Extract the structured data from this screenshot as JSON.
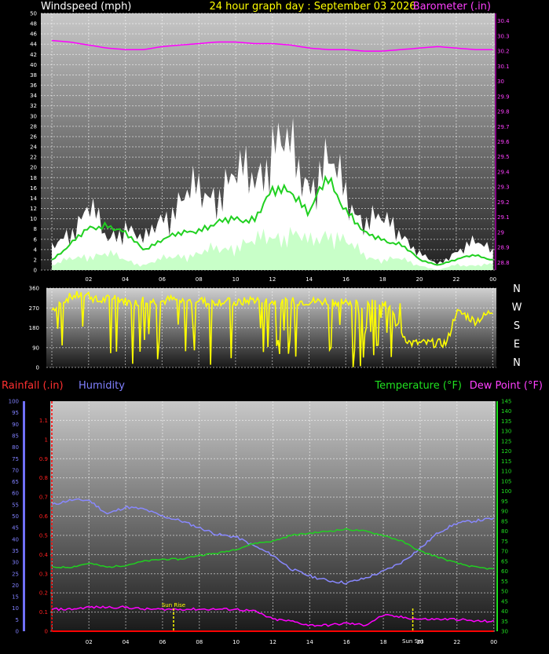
{
  "chart_data": [
    {
      "type": "line",
      "title": "24 hour graph day : September 03 2026",
      "left_label": "Windspeed (mph)",
      "right_label": "Barometer (.in)",
      "y_left_ticks": [
        "0",
        "2",
        "4",
        "6",
        "8",
        "10",
        "12",
        "14",
        "16",
        "18",
        "20",
        "22",
        "24",
        "26",
        "28",
        "30",
        "32",
        "34",
        "36",
        "38",
        "40",
        "42",
        "44",
        "46",
        "48",
        "50"
      ],
      "y_right_ticks": [
        "28.8",
        "28.9",
        "29",
        "29.1",
        "29.2",
        "29.3",
        "29.4",
        "29.5",
        "29.6",
        "29.7",
        "29.8",
        "29.9",
        "30",
        "30.1",
        "30.2",
        "30.3",
        "30.4"
      ],
      "x_ticks": [
        "02",
        "04",
        "06",
        "08",
        "10",
        "12",
        "14",
        "16",
        "18",
        "20",
        "22",
        "00"
      ],
      "ylim_left": [
        0,
        50
      ],
      "ylim_right": [
        28.75,
        30.45
      ],
      "hours": [
        0,
        1,
        2,
        3,
        4,
        5,
        6,
        7,
        8,
        9,
        10,
        11,
        12,
        13,
        14,
        15,
        16,
        17,
        18,
        19,
        20,
        21,
        22,
        23,
        24
      ],
      "series": [
        {
          "key": "gust",
          "color": "#ffffff",
          "values": [
            4,
            8,
            12,
            6,
            9,
            5,
            11,
            13,
            15,
            16,
            17,
            19,
            24,
            22,
            18,
            20,
            15,
            10,
            9,
            8,
            3,
            1,
            4,
            5,
            4
          ]
        },
        {
          "key": "average",
          "color": "#20d020",
          "values": [
            2,
            5,
            8,
            9,
            7,
            4,
            6,
            7,
            8,
            9,
            10,
            10,
            15,
            16,
            11,
            18,
            12,
            7,
            6,
            5,
            2,
            1,
            2,
            3,
            2
          ]
        },
        {
          "key": "minimum",
          "color": "#c8ffc8",
          "values": [
            1,
            2,
            3,
            3,
            2,
            1,
            2,
            3,
            3,
            4,
            5,
            5,
            7,
            7,
            5,
            8,
            5,
            3,
            2,
            2,
            1,
            0,
            1,
            1,
            1
          ]
        },
        {
          "key": "barometer",
          "color": "#ff00ff",
          "values": [
            30.27,
            30.26,
            30.24,
            30.22,
            30.21,
            30.21,
            30.23,
            30.24,
            30.25,
            30.26,
            30.26,
            30.25,
            30.25,
            30.24,
            30.22,
            30.21,
            30.21,
            30.2,
            30.2,
            30.21,
            30.22,
            30.23,
            30.22,
            30.21,
            30.21
          ]
        }
      ]
    },
    {
      "type": "scatter",
      "y_ticks": [
        "0",
        "90",
        "180",
        "270",
        "360"
      ],
      "compass_labels": [
        "N",
        "W",
        "S",
        "E",
        "N"
      ],
      "ylim": [
        0,
        360
      ],
      "x_hours": [
        0,
        0.5,
        1,
        1.5,
        2,
        2.5,
        3,
        3.5,
        4,
        4.5,
        5,
        5.5,
        6,
        6.5,
        7,
        7.5,
        8,
        8.5,
        9,
        9.5,
        10,
        10.5,
        11,
        11.5,
        12,
        12.5,
        13,
        13.5,
        14,
        14.5,
        15,
        15.5,
        16,
        16.5,
        17,
        17.5,
        18,
        18.5,
        19,
        19.5,
        20,
        20.5,
        21,
        21.5,
        22,
        22.5,
        23,
        23.5,
        24
      ],
      "direction_deg": [
        260,
        300,
        320,
        330,
        330,
        300,
        310,
        320,
        300,
        290,
        310,
        300,
        300,
        310,
        300,
        300,
        310,
        290,
        300,
        300,
        290,
        300,
        310,
        300,
        300,
        290,
        300,
        300,
        300,
        300,
        300,
        300,
        300,
        290,
        280,
        300,
        290,
        280,
        160,
        110,
        110,
        110,
        110,
        110,
        250,
        240,
        210,
        230,
        260
      ],
      "color": "#ffff00"
    },
    {
      "type": "line",
      "labels": {
        "rainfall": "Rainfall (.in)",
        "humidity": "Humidity",
        "temperature": "Temperature (°F)",
        "dewpoint": "Dew Point (°F)"
      },
      "humidity_ticks": [
        "0",
        "5",
        "10",
        "15",
        "20",
        "25",
        "30",
        "35",
        "40",
        "45",
        "50",
        "55",
        "60",
        "65",
        "70",
        "75",
        "80",
        "85",
        "90",
        "95",
        "100"
      ],
      "rain_ticks": [
        "0",
        "0.1",
        "0.2",
        "0.3",
        "0.4",
        "0.5",
        "0.6",
        "0.7",
        "0.8",
        "0.9",
        "1",
        "1.1"
      ],
      "temp_ticks": [
        "30",
        "35",
        "40",
        "45",
        "50",
        "55",
        "60",
        "65",
        "70",
        "75",
        "80",
        "85",
        "90",
        "95",
        "100",
        "105",
        "110",
        "115",
        "120",
        "125",
        "130",
        "135",
        "140",
        "145"
      ],
      "x_ticks": [
        "02",
        "04",
        "06",
        "08",
        "10",
        "12",
        "14",
        "16",
        "18",
        "20",
        "22",
        "00"
      ],
      "annotations": [
        {
          "label": "Sun Rise",
          "hour": 6.6
        },
        {
          "label": "Sun Set",
          "hour": 19.6
        }
      ],
      "humidity_range": [
        0,
        100
      ],
      "temp_range": [
        30,
        145
      ],
      "rain_range": [
        0,
        1.2
      ],
      "hours": [
        0,
        1,
        2,
        3,
        4,
        5,
        6,
        7,
        8,
        9,
        10,
        11,
        12,
        13,
        14,
        15,
        16,
        17,
        18,
        19,
        20,
        21,
        22,
        23,
        24
      ],
      "series": [
        {
          "key": "humidity",
          "color": "#8888ff",
          "values": [
            55,
            57,
            57,
            51,
            54,
            53,
            50,
            48,
            45,
            42,
            41,
            37,
            33,
            27,
            24,
            22,
            21,
            23,
            26,
            30,
            36,
            43,
            47,
            48,
            49
          ]
        },
        {
          "key": "temperature",
          "color": "#20d020",
          "values": [
            62,
            62,
            64,
            62,
            63,
            65,
            66,
            66,
            68,
            69,
            71,
            74,
            75,
            78,
            79,
            80,
            81,
            80,
            78,
            75,
            70,
            67,
            64,
            62,
            61
          ]
        },
        {
          "key": "dewpoint",
          "color": "#ff00ff",
          "values": [
            41,
            41,
            42,
            42,
            42,
            41,
            41,
            41,
            41,
            41,
            41,
            40,
            36,
            35,
            33,
            33,
            34,
            33,
            38,
            37,
            36,
            36,
            36,
            35,
            35
          ]
        },
        {
          "key": "rainfall",
          "color": "#ff0000",
          "values": [
            0,
            0,
            0,
            0,
            0,
            0,
            0,
            0,
            0,
            0,
            0,
            0,
            0,
            0,
            0,
            0,
            0,
            0,
            0,
            0,
            0,
            0,
            0,
            0,
            0
          ]
        }
      ]
    }
  ]
}
